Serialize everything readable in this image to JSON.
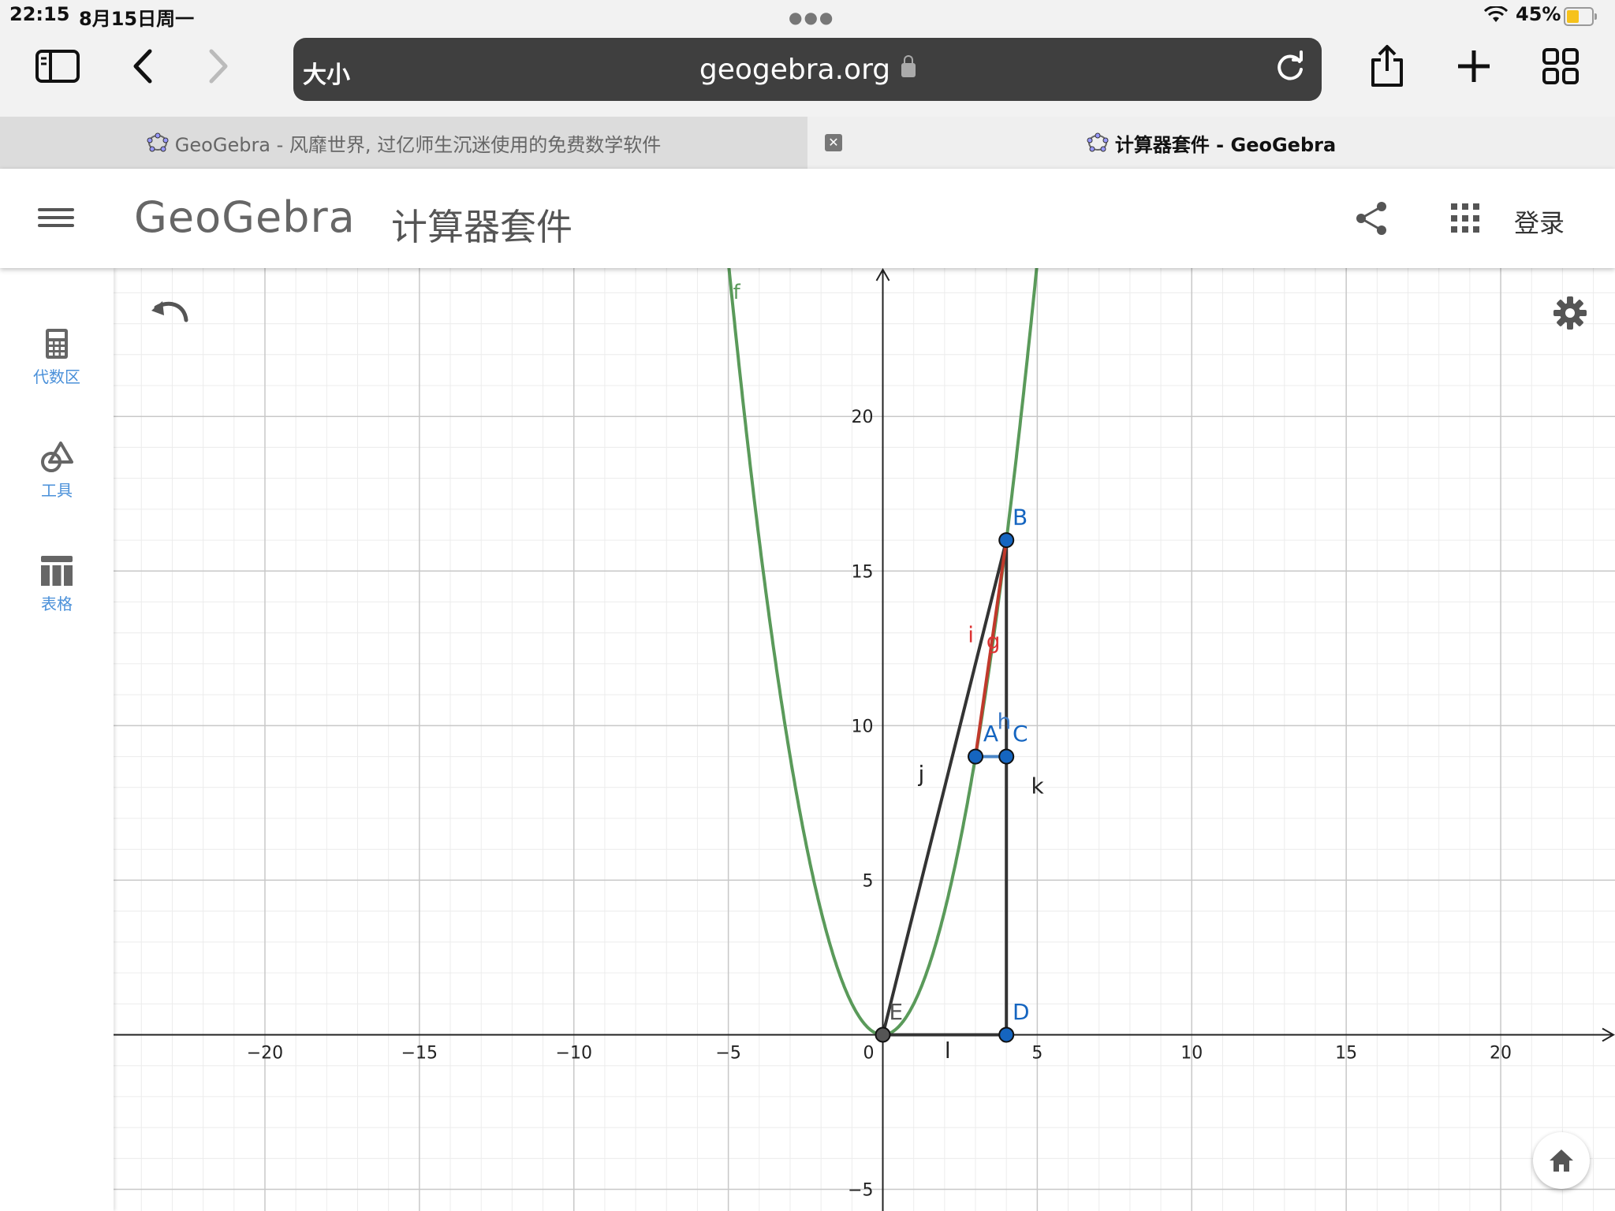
{
  "status": {
    "time": "22:15",
    "date": "8月15日周一",
    "battery": "45%",
    "battery_level": 0.45
  },
  "browser": {
    "font_size_label": "大小",
    "url": "geogebra.org",
    "tabs": [
      {
        "title": "GeoGebra - 风靡世界, 过亿师生沉迷使用的免费数学软件",
        "active": false
      },
      {
        "title": "计算器套件 - GeoGebra",
        "active": true
      }
    ]
  },
  "header": {
    "brand": "GeoGebra",
    "app_title": "计算器套件",
    "login": "登录"
  },
  "sidebar": {
    "items": [
      {
        "label": "代数区",
        "icon": "calculator-icon"
      },
      {
        "label": "工具",
        "icon": "tools-icon"
      },
      {
        "label": "表格",
        "icon": "table-icon"
      }
    ]
  },
  "graph": {
    "x_ticks": [
      "−20",
      "−15",
      "−10",
      "−5",
      "0",
      "5",
      "10",
      "15",
      "20"
    ],
    "y_ticks": [
      "20",
      "15",
      "10",
      "5",
      "−5"
    ],
    "x_range": [
      -24.9,
      23.7
    ],
    "y_range": [
      -5.7,
      24.8
    ],
    "curve_label": "f",
    "curve": "y = x^2",
    "colors": {
      "curve": "#5a9a5a",
      "point": "#1565c0",
      "segment": "#333333",
      "red_segment": "#c0392b",
      "blue_segment": "#4a86c8"
    },
    "points": [
      {
        "name": "A",
        "x": 3,
        "y": 9
      },
      {
        "name": "B",
        "x": 4,
        "y": 16
      },
      {
        "name": "C",
        "x": 4,
        "y": 9
      },
      {
        "name": "D",
        "x": 4,
        "y": 0
      },
      {
        "name": "E",
        "x": 0,
        "y": 0
      }
    ],
    "segment_labels": [
      "g",
      "h",
      "i",
      "j",
      "k",
      "l"
    ]
  }
}
